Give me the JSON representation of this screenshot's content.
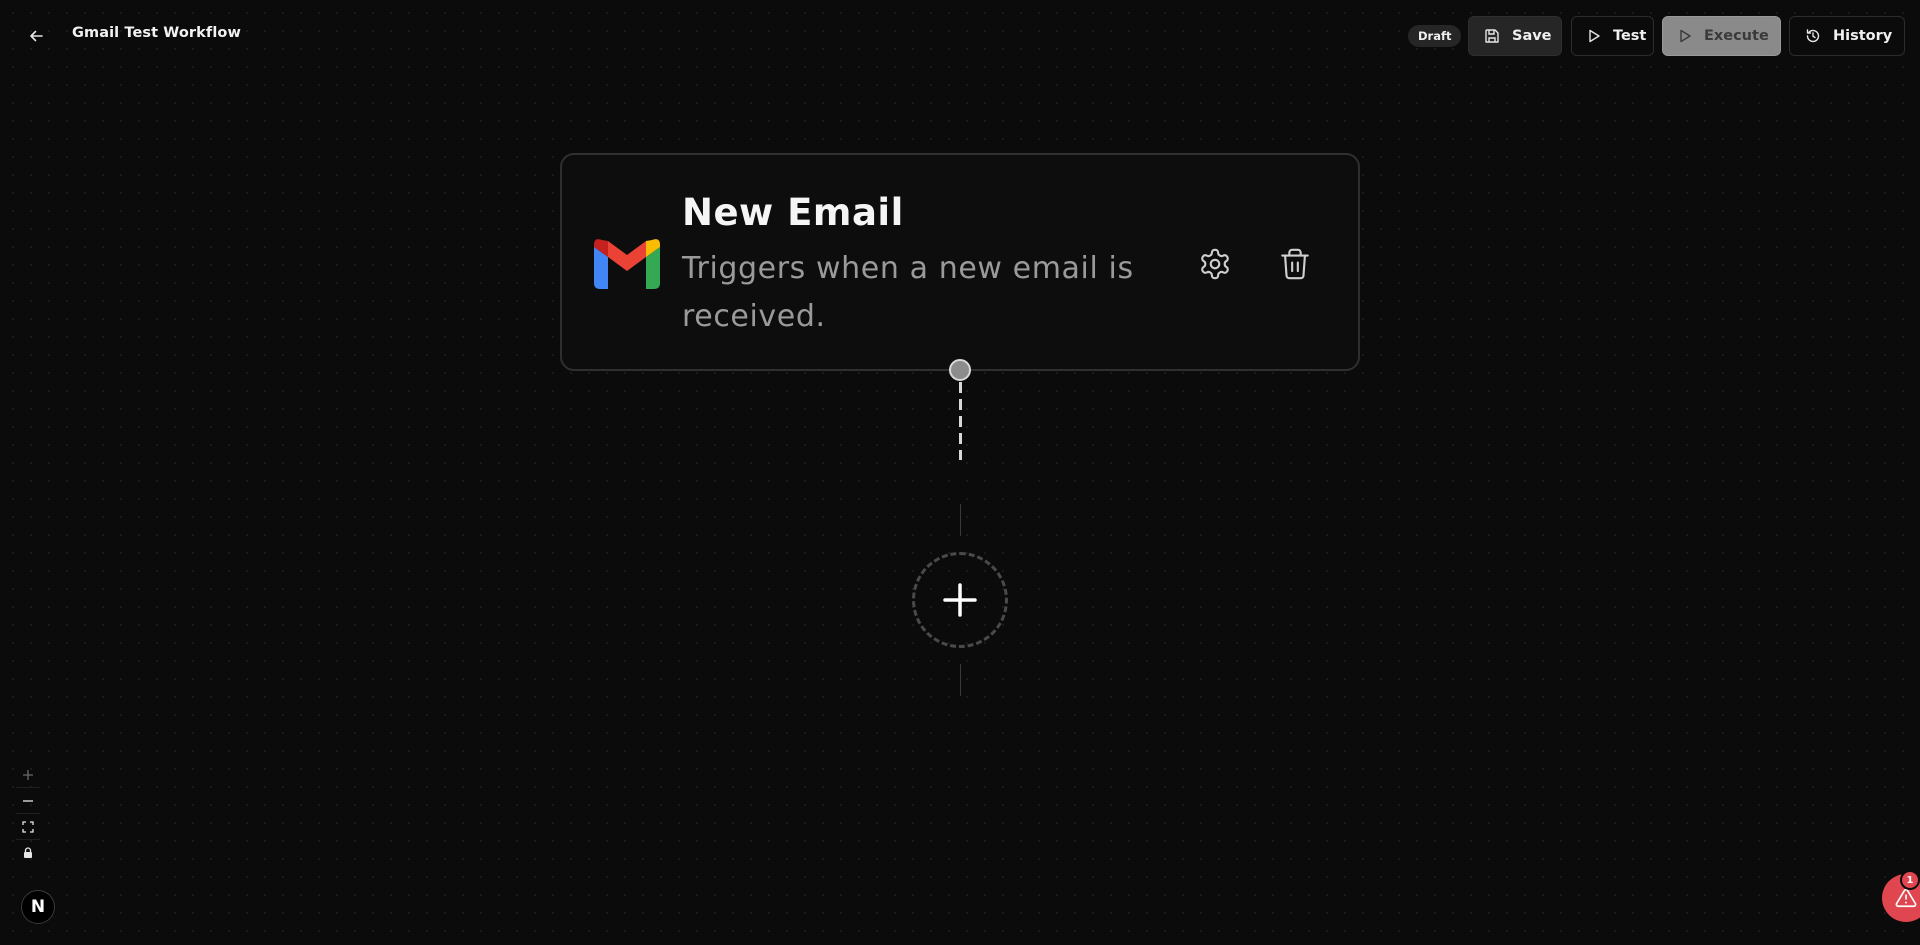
{
  "header": {
    "title": "Gmail Test Workflow",
    "status_badge": "Draft",
    "buttons": {
      "save": "Save",
      "test": "Test",
      "execute": "Execute",
      "history": "History"
    }
  },
  "node": {
    "title": "New Email",
    "description": "Triggers when a new email is received.",
    "icon": "gmail-icon"
  },
  "alerts": {
    "count": "1"
  },
  "logo": {
    "letter": "N"
  }
}
